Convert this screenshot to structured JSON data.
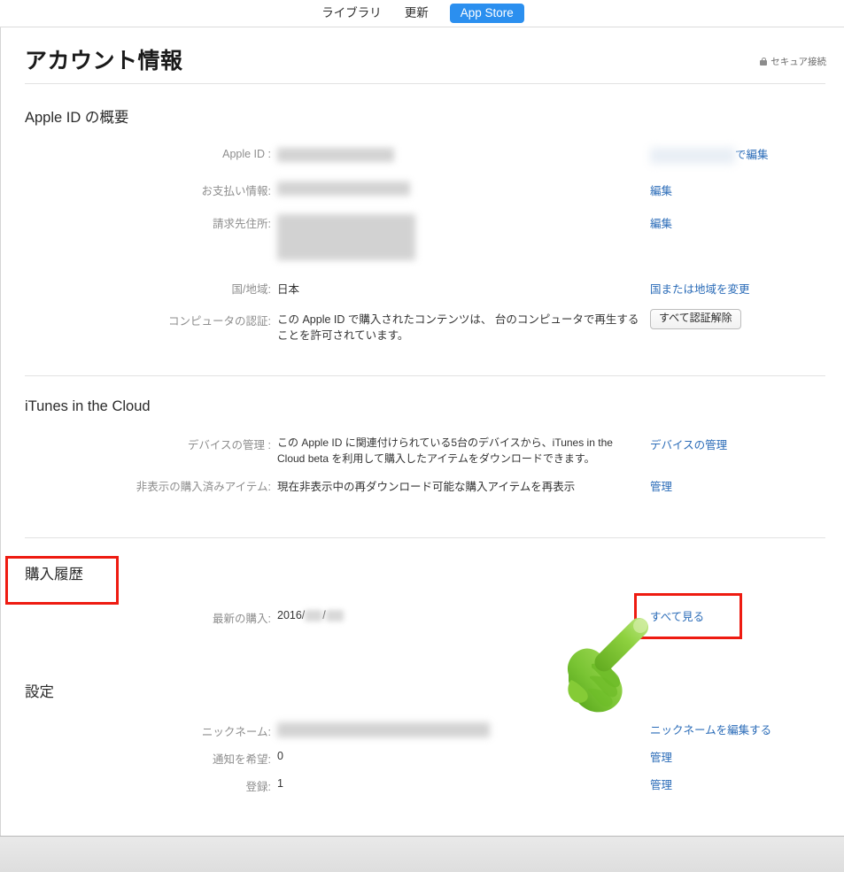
{
  "topnav": {
    "items": [
      {
        "label": "ライブラリ",
        "style": "plain"
      },
      {
        "label": "更新",
        "style": "plain"
      },
      {
        "label": "App Store",
        "style": "pill"
      }
    ],
    "pill_color": "#2b8fef"
  },
  "header": {
    "title": "アカウント情報",
    "secure_label": "セキュア接続",
    "lock_icon": "lock-icon"
  },
  "sections": {
    "apple_id": {
      "title": "Apple ID の概要",
      "rows": [
        {
          "label": "Apple ID :",
          "value": "",
          "redacted": true,
          "action": "で編集",
          "action_type": "link",
          "action_redacted_prefix": true
        },
        {
          "label": "お支払い情報:",
          "value": "",
          "redacted": true,
          "action": "編集",
          "action_type": "link"
        },
        {
          "label": "請求先住所:",
          "value": "",
          "redacted": true,
          "action": "編集",
          "action_type": "link"
        },
        {
          "label": "国/地域:",
          "value": "日本",
          "redacted": false,
          "action": "国または地域を変更",
          "action_type": "link"
        },
        {
          "label": "コンピュータの認証:",
          "value": "この Apple ID で購入されたコンテンツは、 台のコンピュータで再生することを許可されています。",
          "redacted": false,
          "action": "すべて認証解除",
          "action_type": "button"
        }
      ]
    },
    "itunes_cloud": {
      "title": "iTunes in the Cloud",
      "rows": [
        {
          "label": "デバイスの管理 :",
          "value": "この Apple ID に関連付けられている5台のデバイスから、iTunes in the Cloud beta を利用して購入したアイテムをダウンロードできます。",
          "action": "デバイスの管理",
          "action_type": "link"
        },
        {
          "label": "非表示の購入済みアイテム:",
          "value": "現在非表示中の再ダウンロード可能な購入アイテムを再表示",
          "action": "管理",
          "action_type": "link"
        }
      ]
    },
    "purchase_history": {
      "title": "購入履歴",
      "rows": [
        {
          "label": "最新の購入:",
          "value": "2016/",
          "value_suffix": "/",
          "redacted_parts": true,
          "action": "すべて見る",
          "action_type": "link"
        }
      ]
    },
    "settings": {
      "title": "設定",
      "rows": [
        {
          "label": "ニックネーム:",
          "value": "",
          "redacted": true,
          "action": "ニックネームを編集する",
          "action_type": "link"
        },
        {
          "label": "通知を希望:",
          "value": "0",
          "redacted": false,
          "action": "管理",
          "action_type": "link"
        },
        {
          "label": "登録:",
          "value": "1",
          "redacted": false,
          "action": "管理",
          "action_type": "link"
        }
      ]
    }
  },
  "annotations": {
    "color": "#ee1b11",
    "boxes": [
      {
        "name": "purchase-history-highlight",
        "target": "購入履歴"
      },
      {
        "name": "view-all-highlight",
        "target": "すべて見る"
      }
    ],
    "cursor": {
      "name": "hand-cursor",
      "color": "#6fc426"
    }
  }
}
